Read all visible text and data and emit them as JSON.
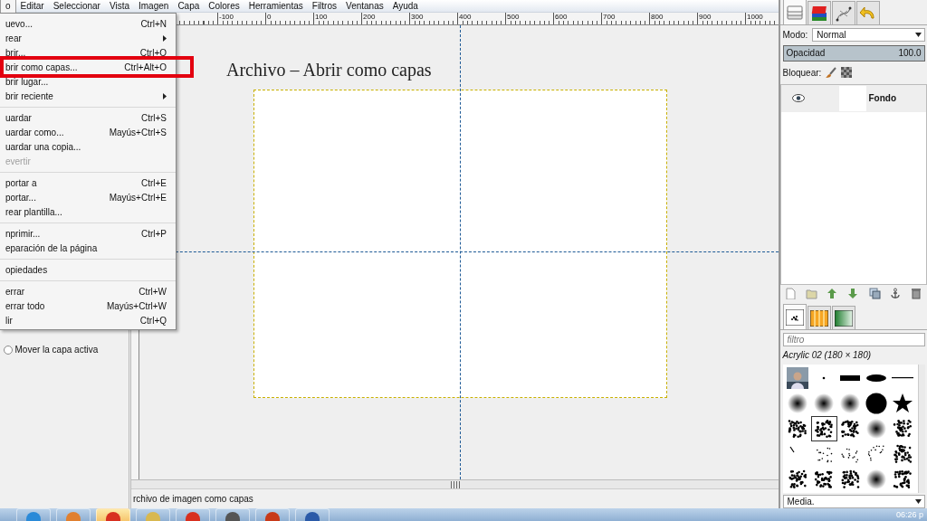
{
  "menubar": [
    {
      "label": "o",
      "selected": true
    },
    {
      "label": "Editar",
      "selected": false
    },
    {
      "label": "Seleccionar",
      "selected": false
    },
    {
      "label": "Vista",
      "selected": false
    },
    {
      "label": "Imagen",
      "selected": false
    },
    {
      "label": "Capa",
      "selected": false
    },
    {
      "label": "Colores",
      "selected": false
    },
    {
      "label": "Herramientas",
      "selected": false
    },
    {
      "label": "Filtros",
      "selected": false
    },
    {
      "label": "Ventanas",
      "selected": false
    },
    {
      "label": "Ayuda",
      "selected": false
    }
  ],
  "file_menu": {
    "groups": [
      [
        {
          "label": "uevo...",
          "shortcut": "Ctrl+N",
          "submenu": false,
          "disabled": false,
          "boxed": false
        },
        {
          "label": "rear",
          "submenu": true,
          "disabled": false,
          "boxed": false
        },
        {
          "label": "brir...",
          "shortcut": "Ctrl+O",
          "submenu": false,
          "disabled": false,
          "boxed": false
        },
        {
          "label": "brir como capas...",
          "shortcut": "Ctrl+Alt+O",
          "submenu": false,
          "disabled": false,
          "boxed": true
        },
        {
          "label": "brir lugar...",
          "submenu": false,
          "disabled": false,
          "boxed": false
        },
        {
          "label": "brir reciente",
          "submenu": true,
          "disabled": false,
          "boxed": false
        }
      ],
      [
        {
          "label": "uardar",
          "shortcut": "Ctrl+S",
          "submenu": false,
          "disabled": false,
          "boxed": false
        },
        {
          "label": "uardar como...",
          "shortcut": "Mayús+Ctrl+S",
          "submenu": false,
          "disabled": false,
          "boxed": false
        },
        {
          "label": "uardar una copia...",
          "submenu": false,
          "disabled": false,
          "boxed": false
        },
        {
          "label": "evertir",
          "submenu": false,
          "disabled": true,
          "boxed": false
        }
      ],
      [
        {
          "label": "portar a",
          "shortcut": "Ctrl+E",
          "submenu": false,
          "disabled": false,
          "boxed": false
        },
        {
          "label": "portar...",
          "shortcut": "Mayús+Ctrl+E",
          "submenu": false,
          "disabled": false,
          "boxed": false
        },
        {
          "label": "rear plantilla...",
          "submenu": false,
          "disabled": false,
          "boxed": false
        }
      ],
      [
        {
          "label": "nprimir...",
          "shortcut": "Ctrl+P",
          "submenu": false,
          "disabled": false,
          "boxed": false
        },
        {
          "label": "eparación de la página",
          "submenu": false,
          "disabled": false,
          "boxed": false
        }
      ],
      [
        {
          "label": "opiedades",
          "submenu": false,
          "disabled": false,
          "boxed": false
        }
      ],
      [
        {
          "label": "errar",
          "shortcut": "Ctrl+W",
          "submenu": false,
          "disabled": false,
          "boxed": false
        },
        {
          "label": "errar todo",
          "shortcut": "Mayús+Ctrl+W",
          "submenu": false,
          "disabled": false,
          "boxed": false
        },
        {
          "label": "lir",
          "shortcut": "Ctrl+Q",
          "submenu": false,
          "disabled": false,
          "boxed": false
        }
      ]
    ]
  },
  "toolbox": {
    "option": {
      "label": "Mover la capa activa",
      "checked": false
    }
  },
  "ruler": {
    "ticks": [
      "-100",
      "0",
      "100",
      "200",
      "300",
      "400",
      "500",
      "600",
      "700",
      "800",
      "900",
      "1000"
    ]
  },
  "canvas": {
    "caption": "Archivo – Abrir como capas"
  },
  "status_bar": "rchivo de imagen como capas",
  "layers_panel": {
    "tabs": [
      {
        "selected": true
      },
      {
        "selected": false
      },
      {
        "selected": false
      },
      {
        "selected": false
      }
    ],
    "mode_label": "Modo:",
    "mode": "Normal",
    "opacity_label": "Opacidad",
    "opacity": "100.0",
    "level": 1,
    "lock_label": "Bloquear:",
    "layers": [
      {
        "name": "Fondo",
        "visible": true
      }
    ]
  },
  "brushes_panel": {
    "tabs": [
      {
        "selected": true
      },
      {
        "selected": false
      },
      {
        "selected": false
      }
    ],
    "filter_placeholder": "filtro",
    "brush_name": "Acrylic 02 (180 × 180)",
    "brushes": [
      {
        "kind": "picture",
        "selected": false
      },
      {
        "kind": "dot",
        "selected": false
      },
      {
        "kind": "bar",
        "selected": false
      },
      {
        "kind": "ellipse",
        "selected": false
      },
      {
        "kind": "line",
        "selected": false
      },
      {
        "kind": "blur",
        "selected": false
      },
      {
        "kind": "blur",
        "selected": false
      },
      {
        "kind": "blur",
        "selected": false
      },
      {
        "kind": "circle",
        "selected": false
      },
      {
        "kind": "star",
        "selected": false
      },
      {
        "kind": "splatter",
        "selected": false
      },
      {
        "kind": "splatter",
        "selected": true
      },
      {
        "kind": "splatter",
        "selected": false
      },
      {
        "kind": "blur",
        "selected": false
      },
      {
        "kind": "splatter",
        "selected": false
      },
      {
        "kind": "streak",
        "selected": false
      },
      {
        "kind": "scatter",
        "selected": false
      },
      {
        "kind": "scatter",
        "selected": false
      },
      {
        "kind": "scatter",
        "selected": false
      },
      {
        "kind": "splatter",
        "selected": false
      },
      {
        "kind": "splatter",
        "selected": false
      },
      {
        "kind": "splatter",
        "selected": false
      },
      {
        "kind": "splatter",
        "selected": false
      },
      {
        "kind": "blur",
        "selected": false
      },
      {
        "kind": "splatter",
        "selected": false
      }
    ],
    "category": "Media."
  },
  "taskbar": {
    "buttons": [
      {
        "selected": false
      },
      {
        "selected": false
      },
      {
        "selected": true
      },
      {
        "selected": false
      },
      {
        "selected": false
      },
      {
        "selected": false
      },
      {
        "selected": false
      },
      {
        "selected": false
      }
    ],
    "clock": "06:26 p"
  }
}
